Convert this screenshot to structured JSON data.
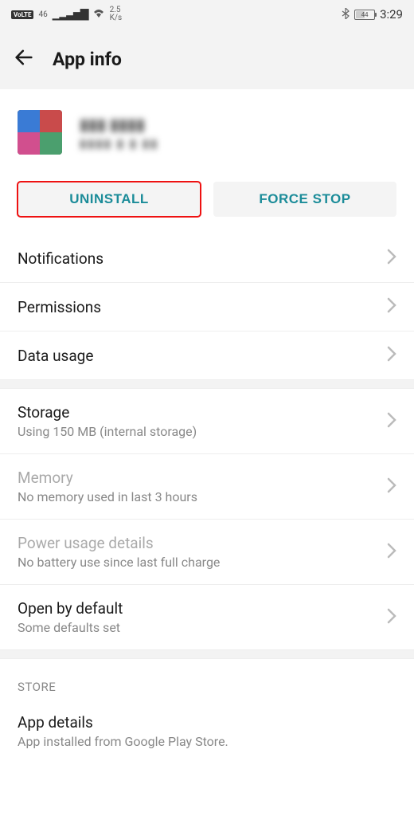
{
  "statusbar": {
    "volte": "VoLTE",
    "net_gen": "46",
    "speed_top": "2.5",
    "speed_bot": "K/s",
    "battery": "44",
    "time": "3:29"
  },
  "header": {
    "title": "App info"
  },
  "app": {
    "name_blurred": "▮▮▮ ▮▮▮▮",
    "meta_blurred": "▮▮▮▮ ▮ ▮ ▮▮"
  },
  "actions": {
    "uninstall": "UNINSTALL",
    "force_stop": "FORCE STOP"
  },
  "rows": {
    "notifications": "Notifications",
    "permissions": "Permissions",
    "data_usage": "Data usage",
    "storage": {
      "title": "Storage",
      "sub": "Using 150 MB (internal storage)"
    },
    "memory": {
      "title": "Memory",
      "sub": "No memory used in last 3 hours"
    },
    "power": {
      "title": "Power usage details",
      "sub": "No battery use since last full charge"
    },
    "open_default": {
      "title": "Open by default",
      "sub": "Some defaults set"
    }
  },
  "store": {
    "header": "STORE",
    "details_title": "App details",
    "details_sub": "App installed from Google Play Store."
  }
}
